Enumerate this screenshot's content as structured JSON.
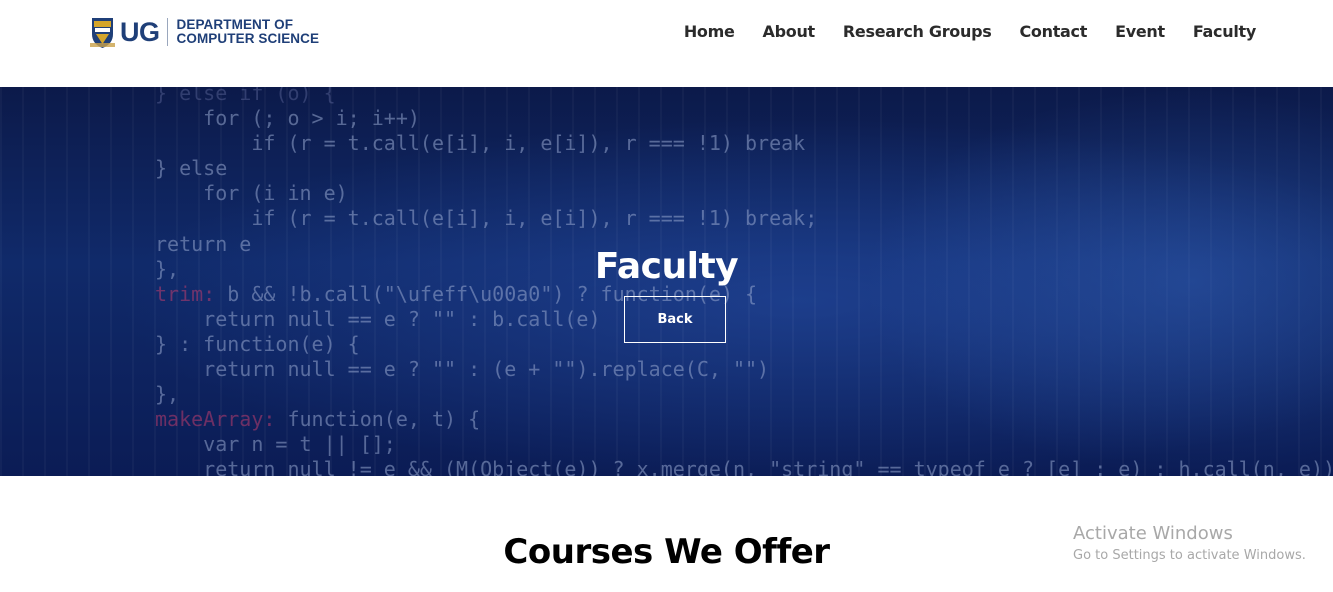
{
  "logo": {
    "abbr": "UG",
    "dept_line1": "DEPARTMENT OF",
    "dept_line2": "COMPUTER SCIENCE"
  },
  "nav": {
    "items": [
      {
        "label": "Home"
      },
      {
        "label": "About"
      },
      {
        "label": "Research Groups"
      },
      {
        "label": "Contact"
      },
      {
        "label": "Event"
      },
      {
        "label": "Faculty"
      }
    ]
  },
  "hero": {
    "title": "Faculty",
    "back_label": "Back"
  },
  "main": {
    "section_title": "Courses We Offer"
  },
  "watermark": {
    "line1": "Activate Windows",
    "line2": "Go to Settings to activate Windows."
  },
  "colors": {
    "brand": "#1f3f78",
    "hero_bg": "#102a6a",
    "nav_text": "#2b2b2b"
  }
}
